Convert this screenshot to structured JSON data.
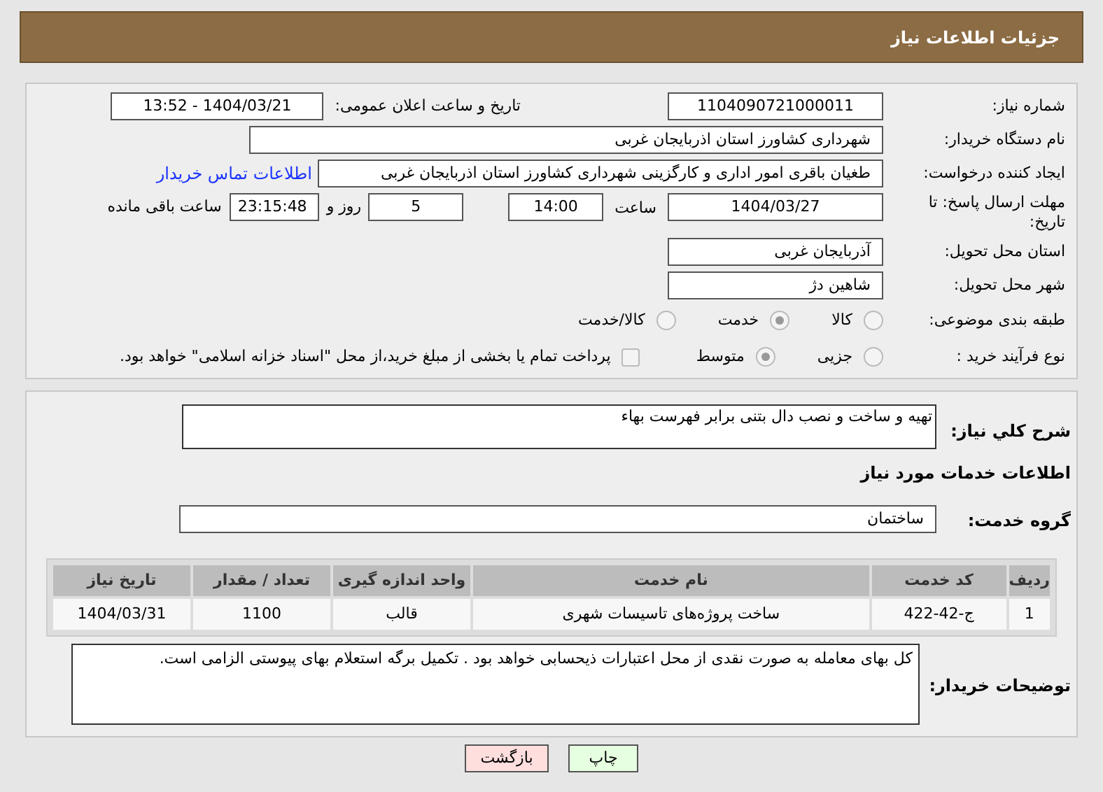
{
  "header": {
    "title": "جزئیات اطلاعات نیاز"
  },
  "need_number": {
    "label": "شماره نیاز:",
    "value": "1104090721000011"
  },
  "announce": {
    "label": "تاریخ و ساعت اعلان عمومی:",
    "value": "1404/03/21 - 13:52"
  },
  "buyer_org": {
    "label": "نام دستگاه خریدار:",
    "value": "شهرداری کشاورز استان اذربایجان غربی"
  },
  "creator": {
    "label": "ایجاد کننده درخواست:",
    "value": "طغیان باقری امور اداری و کارگزینی شهرداری کشاورز استان اذربایجان غربی",
    "link": "اطلاعات تماس خریدار"
  },
  "deadline": {
    "label": "مهلت ارسال پاسخ: تا تاریخ:",
    "date": "1404/03/27",
    "time_label": "ساعت",
    "time": "14:00",
    "days": "5",
    "days_label": "روز و",
    "remaining": "23:15:48",
    "remaining_label": "ساعت باقی مانده"
  },
  "province": {
    "label": "استان محل تحویل:",
    "value": "آذربایجان غربی"
  },
  "city": {
    "label": "شهر محل تحویل:",
    "value": "شاهین دژ"
  },
  "category": {
    "label": "طبقه بندی موضوعی:",
    "options": [
      {
        "label": "کالا",
        "selected": false
      },
      {
        "label": "خدمت",
        "selected": true
      },
      {
        "label": "کالا/خدمت",
        "selected": false
      }
    ]
  },
  "process": {
    "label": "نوع فرآیند خرید :",
    "options": [
      {
        "label": "جزیی",
        "selected": false
      },
      {
        "label": "متوسط",
        "selected": true
      }
    ],
    "checkbox": {
      "label": "پرداخت تمام یا بخشی از مبلغ خرید،از محل \"اسناد خزانه اسلامی\" خواهد بود.",
      "checked": false
    }
  },
  "description": {
    "label": "شرح کلي نياز:",
    "value": "تهیه و ساخت و نصب دال بتنی برابر فهرست بهاء"
  },
  "services_title": "اطلاعات خدمات مورد نیاز",
  "service_group": {
    "label": "گروه خدمت:",
    "value": "ساختمان"
  },
  "table": {
    "columns": [
      "ردیف",
      "کد خدمت",
      "نام خدمت",
      "واحد اندازه گیری",
      "تعداد / مقدار",
      "تاریخ نیاز"
    ],
    "rows": [
      [
        "1",
        "ج-42-422",
        "ساخت پروژه‌های تاسیسات شهری",
        "قالب",
        "1100",
        "1404/03/31"
      ]
    ]
  },
  "buyer_notes": {
    "label": "توضیحات خریدار:",
    "value": "کل بهای معامله به صورت نقدی از محل اعتبارات ذیحسابی خواهد بود . تکمیل برگه استعلام بهای پیوستی الزامی است."
  },
  "buttons": [
    {
      "label": "چاپ",
      "kind": "print"
    },
    {
      "label": "بازگشت",
      "kind": "back"
    }
  ]
}
